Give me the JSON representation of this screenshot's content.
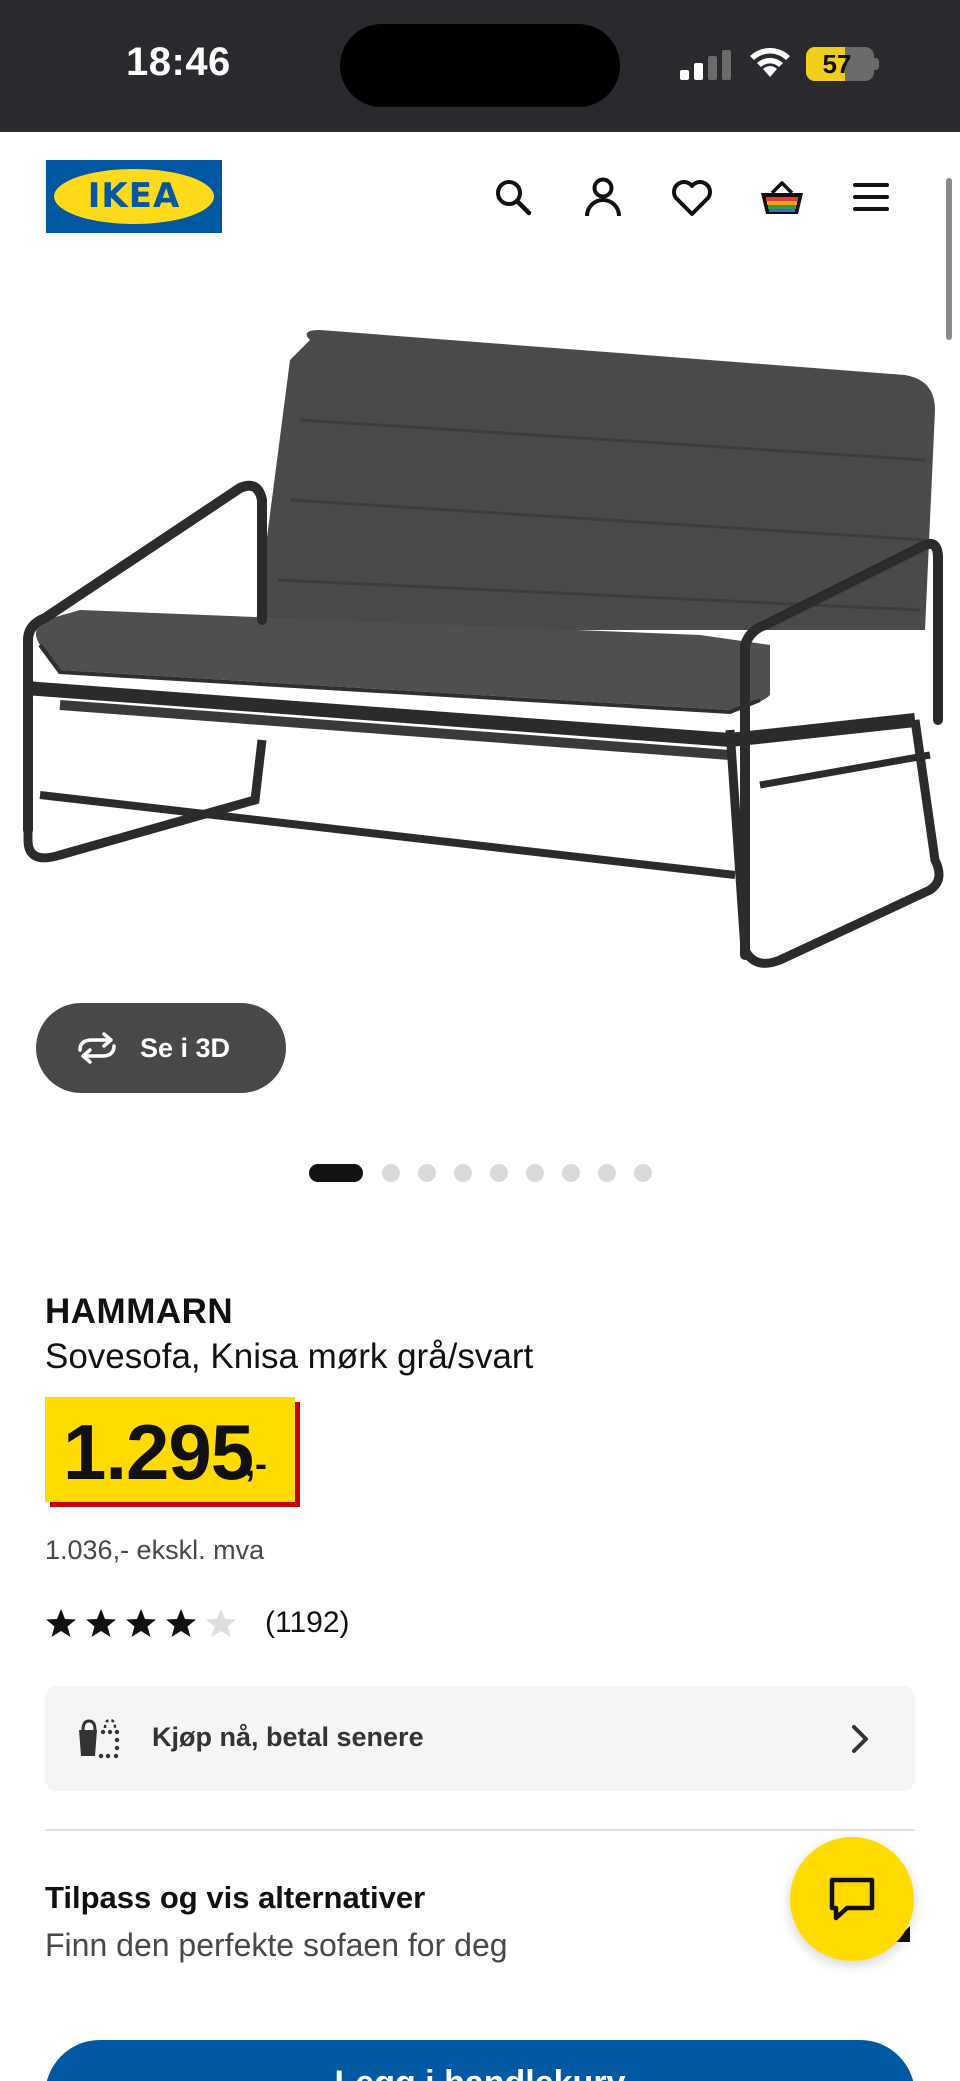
{
  "status_bar": {
    "time": "18:46",
    "battery_level": "57",
    "battery_fraction": 0.57
  },
  "header": {
    "logo_text": "IKEA",
    "icons": [
      "search-icon",
      "account-icon",
      "wishlist-heart-icon",
      "shopping-cart-icon",
      "menu-icon"
    ],
    "colors": {
      "ikea_blue": "#0058a3",
      "ikea_yellow": "#ffda1a"
    }
  },
  "gallery": {
    "view_3d_label": "Se i 3D",
    "image_count": 9,
    "active_index": 0
  },
  "product": {
    "name": "HAMMARN",
    "description": "Sovesofa, Knisa mørk grå/svart",
    "price": "1.295",
    "price_suffix": ",-",
    "price_ex_vat": "1.036,- ekskl. mva",
    "rating": 4,
    "rating_max": 5,
    "review_count": "(1192)"
  },
  "pay_later": {
    "label": "Kjøp nå, betal senere"
  },
  "customize": {
    "title": "Tilpass og vis alternativer",
    "subtitle": "Finn den perfekte sofaen for deg"
  },
  "cart": {
    "label": "Legg i handlekurv"
  },
  "chat": {
    "icon": "chat-bubble-icon",
    "color": "#ffdb00"
  }
}
